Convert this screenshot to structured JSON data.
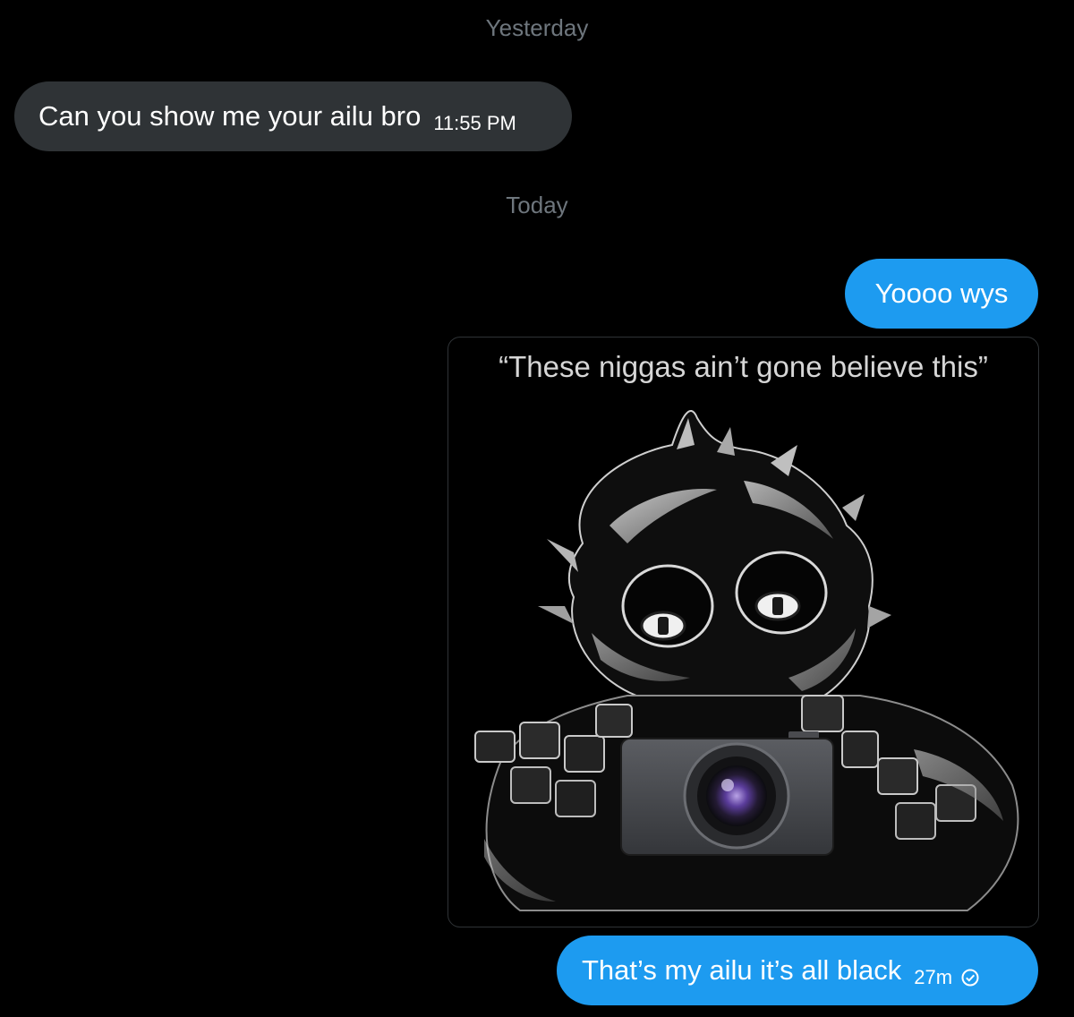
{
  "thread": {
    "divider_yesterday": "Yesterday",
    "divider_today": "Today",
    "messages": [
      {
        "text": "Can you show me your ailu bro",
        "time": "11:55 PM"
      },
      {
        "text": "Yoooo wys"
      },
      {
        "caption": "“These niggas ain’t gone believe this”"
      },
      {
        "text": "That’s my ailu it’s all black",
        "time": "27m",
        "status_icon": "check-circle-icon"
      }
    ]
  },
  "colors": {
    "background": "#000000",
    "incoming_bubble": "#2f3336",
    "outgoing_bubble": "#1d9bf0",
    "muted_text": "#6e767d"
  }
}
